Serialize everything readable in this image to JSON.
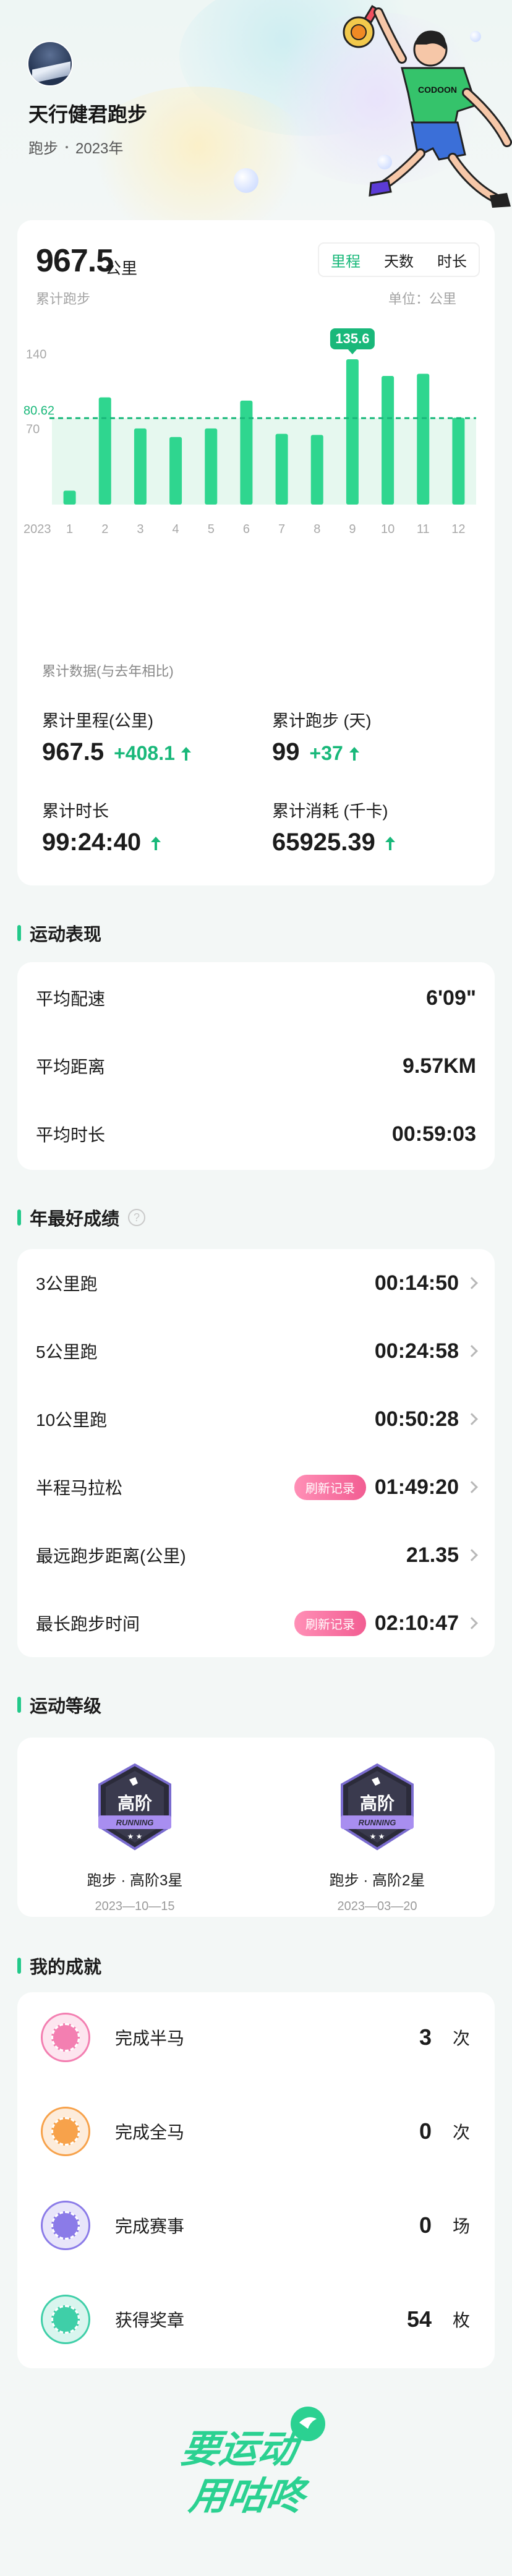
{
  "profile": {
    "name": "天行健君跑步",
    "sport": "跑步",
    "year": "2023年"
  },
  "summary": {
    "total": "967.5",
    "unit": "公里",
    "label": "累计跑步",
    "tabs": [
      "里程",
      "天数",
      "时长"
    ],
    "active_tab": "里程",
    "unit_label": "单位：公里"
  },
  "chart_data": {
    "type": "bar",
    "categories": [
      "1",
      "2",
      "3",
      "4",
      "5",
      "6",
      "7",
      "8",
      "9",
      "10",
      "11",
      "12"
    ],
    "values": [
      13,
      100,
      71,
      63,
      71,
      97,
      66,
      65,
      135.6,
      120,
      122,
      81
    ],
    "x_prefix_label": "2023",
    "y_ticks": [
      "140",
      "70"
    ],
    "average": 80.62,
    "average_label": "80.62",
    "highlight_label": "135.6",
    "highlight_index": 8,
    "ylim": [
      0,
      150
    ],
    "colors": {
      "bar": "#2fd68f",
      "average": "#19b87a"
    }
  },
  "comparison": {
    "title": "累计数据(与去年相比)",
    "items": [
      {
        "label": "累计里程(公里)",
        "value": "967.5",
        "delta": "+408.1"
      },
      {
        "label": "累计跑步 (天)",
        "value": "99",
        "delta": "+37"
      },
      {
        "label": "累计时长",
        "value": "99:24:40",
        "delta": ""
      },
      {
        "label": "累计消耗 (千卡)",
        "value": "65925.39",
        "delta": ""
      }
    ]
  },
  "performance": {
    "title": "运动表现",
    "rows": [
      {
        "label": "平均配速",
        "value": "6'09\""
      },
      {
        "label": "平均距离",
        "value": "9.57KM"
      },
      {
        "label": "平均时长",
        "value": "00:59:03"
      }
    ]
  },
  "best": {
    "title": "年最好成绩",
    "help": "?",
    "rows": [
      {
        "label": "3公里跑",
        "value": "00:14:50",
        "badge": ""
      },
      {
        "label": "5公里跑",
        "value": "00:24:58",
        "badge": ""
      },
      {
        "label": "10公里跑",
        "value": "00:50:28",
        "badge": ""
      },
      {
        "label": "半程马拉松",
        "value": "01:49:20",
        "badge": "刷新记录"
      },
      {
        "label": "最远跑步距离(公里)",
        "value": "21.35",
        "badge": ""
      },
      {
        "label": "最长跑步时间",
        "value": "02:10:47",
        "badge": "刷新记录"
      }
    ]
  },
  "levels": {
    "title": "运动等级",
    "items": [
      {
        "badge_text": "高阶",
        "badge_sub": "RUNNING",
        "name": "跑步 · 高阶3星",
        "date": "2023—10—15"
      },
      {
        "badge_text": "高阶",
        "badge_sub": "RUNNING",
        "name": "跑步 · 高阶2星",
        "date": "2023—03—20"
      }
    ]
  },
  "achievements": {
    "title": "我的成就",
    "items": [
      {
        "label": "完成半马",
        "value": "3",
        "unit": "次",
        "icon": "half-marathon-medal-icon",
        "color": "#f37fb1"
      },
      {
        "label": "完成全马",
        "value": "0",
        "unit": "次",
        "icon": "full-marathon-medal-icon",
        "color": "#f7a24b"
      },
      {
        "label": "完成赛事",
        "value": "0",
        "unit": "场",
        "icon": "event-medal-icon",
        "color": "#8b7be8"
      },
      {
        "label": "获得奖章",
        "value": "54",
        "unit": "枚",
        "icon": "award-medal-icon",
        "color": "#3fcfa8"
      }
    ]
  },
  "brand": {
    "line1": "要运动",
    "line2": "用咕咚",
    "color": "#2bd191"
  }
}
